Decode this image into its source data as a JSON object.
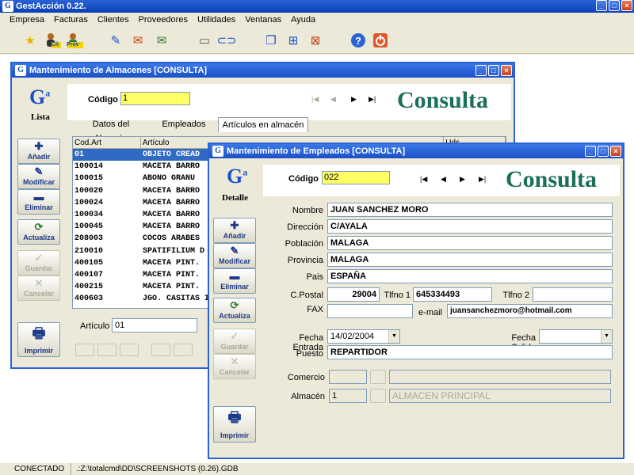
{
  "app": {
    "title": "GestAcción 0.22."
  },
  "menu": [
    "Empresa",
    "Facturas",
    "Clientes",
    "Proveedores",
    "Utilidades",
    "Ventanas",
    "Ayuda"
  ],
  "toolbar": {
    "icons": [
      "star-icon",
      "customers-icon",
      "suppliers-icon",
      "edit-document-icon",
      "send-mail-icon",
      "receive-mail-icon",
      "notepad-icon",
      "link-icon",
      "cascade-windows-icon",
      "tile-windows-icon",
      "close-windows-icon",
      "help-icon",
      "power-icon"
    ],
    "cli_badge": "Cli",
    "prov_badge": "Prov"
  },
  "almacenes": {
    "title": "Mantenimiento de Almacenes    [CONSULTA]",
    "side_label": "Lista",
    "codigo_label": "Código",
    "codigo_value": "1",
    "consulta_label": "Consulta",
    "tabs": [
      "Datos del Almacén",
      "Empleados",
      "Artículos en almacén"
    ],
    "columns": [
      "Cod.Art",
      "Artículo",
      "Uds"
    ],
    "rows": [
      [
        "01",
        "OBJETO CREAD"
      ],
      [
        "100014",
        "MACETA BARRO"
      ],
      [
        "100015",
        "ABONO GRANU"
      ],
      [
        "100020",
        "MACETA BARRO"
      ],
      [
        "100024",
        "MACETA BARRO"
      ],
      [
        "100034",
        "MACETA BARRO"
      ],
      [
        "100045",
        "MACETA BARRO"
      ],
      [
        "208003",
        "COCOS ARABES"
      ],
      [
        "210010",
        "SPATIFILIUM D"
      ],
      [
        "400105",
        "MACETA PINT."
      ],
      [
        "400107",
        "MACETA PINT."
      ],
      [
        "400215",
        "MACETA PINT."
      ],
      [
        "400603",
        "JGO. CASITAS I"
      ]
    ],
    "articulo_label": "Artículo",
    "articulo_value": "01",
    "buttons": {
      "add": "Añadir",
      "modify": "Modificar",
      "delete": "Eliminar",
      "refresh": "Actualiza",
      "save": "Guardar",
      "cancel": "Cancelar",
      "print": "Imprimir"
    }
  },
  "empleados": {
    "title": "Mantenimiento de Empleados    [CONSULTA]",
    "side_label": "Detalle",
    "codigo_label": "Código",
    "codigo_value": "022",
    "consulta_label": "Consulta",
    "buttons": {
      "add": "Añadir",
      "modify": "Modificar",
      "delete": "Eliminar",
      "refresh": "Actualiza",
      "save": "Guardar",
      "cancel": "Cancelar",
      "print": "Imprimir"
    },
    "fields": {
      "nombre_label": "Nombre",
      "nombre": "JUAN SANCHEZ MORO",
      "direccion_label": "Dirección",
      "direccion": "C/AYALA",
      "poblacion_label": "Población",
      "poblacion": "MALAGA",
      "provincia_label": "Provincia",
      "provincia": "MALAGA",
      "pais_label": "Pais",
      "pais": "ESPAÑA",
      "cpostal_label": "C.Postal",
      "cpostal": "29004",
      "tlfno1_label": "Tlfno 1",
      "tlfno1": "645334493",
      "tlfno2_label": "Tlfno 2",
      "tlfno2": "",
      "fax_label": "FAX",
      "fax": "",
      "email_label": "e-mail",
      "email": "juansanchezmoro@hotmail.com",
      "fecha_entrada_label": "Fecha Entrada",
      "fecha_entrada": "14/02/2004",
      "fecha_salida_label": "Fecha Salida",
      "fecha_salida": "",
      "puesto_label": "Puesto",
      "puesto": "REPARTIDOR",
      "comercio_label": "Comercio",
      "comercio_code": "",
      "comercio_name": "",
      "almacen_label": "Almacén",
      "almacen_code": "1",
      "almacen_name": "ALMACEN PRINCIPAL"
    }
  },
  "status": {
    "connection": "CONECTADO",
    "path": ".:Z:\\totalcmd\\DD\\SCREENSHOTS (0.26).GDB"
  }
}
